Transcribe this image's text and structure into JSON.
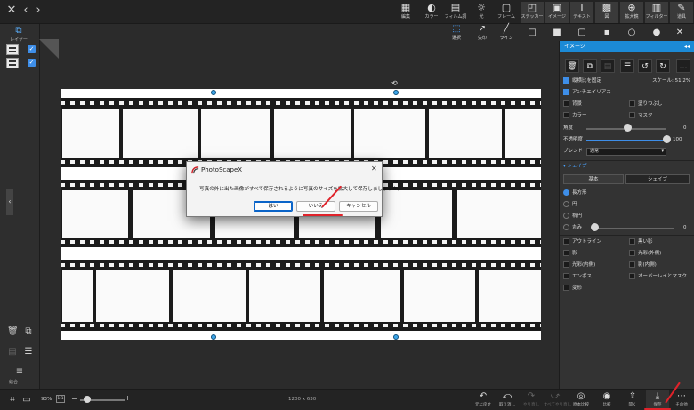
{
  "toolbar": {
    "tools": [
      {
        "label": "編集",
        "icon": "edit-icon"
      },
      {
        "label": "カラー",
        "icon": "color-icon"
      },
      {
        "label": "フィルム調",
        "icon": "film-icon"
      },
      {
        "label": "光",
        "icon": "light-icon"
      },
      {
        "label": "フレーム",
        "icon": "frame-icon"
      },
      {
        "label": "ステッカー",
        "icon": "sticker-icon"
      },
      {
        "label": "イメージ",
        "icon": "image-icon"
      },
      {
        "label": "テキスト",
        "icon": "text-icon"
      },
      {
        "label": "図",
        "icon": "figure-icon"
      },
      {
        "label": "拡大鏡",
        "icon": "magnifier-icon"
      },
      {
        "label": "フィルター",
        "icon": "filter-icon"
      },
      {
        "label": "道具",
        "icon": "tools-icon"
      }
    ]
  },
  "left_panel": {
    "layers_label": "レイヤー",
    "merge_label": "結合"
  },
  "select_tools": [
    {
      "label": "選択"
    },
    {
      "label": "矢印"
    },
    {
      "label": "ライン"
    }
  ],
  "right_panel": {
    "header": "イメージ",
    "scale_label": "スケール: 51.2%",
    "keep_ratio": "縦横比を固定",
    "antialias": "アンチエイリアス",
    "background": "背景",
    "fill": "塗りつぶし",
    "color": "カラー",
    "mask": "マスク",
    "angle_label": "角度",
    "angle_value": "0",
    "opacity_label": "不透明度",
    "opacity_value": "100",
    "opacity_fraction": 1.0,
    "blend_label": "ブレンド",
    "blend_value": "通常",
    "shape_section": "シェイプ",
    "seg_standard": "基本",
    "seg_shape": "シェイプ",
    "shape_rect": "長方形",
    "shape_circle": "円",
    "shape_ellipse": "楕円",
    "shape_round": "丸み",
    "shape_round_value": "0",
    "effects": [
      {
        "left": "アウトライン",
        "right": "黒い影"
      },
      {
        "left": "影",
        "right": "光彩(外側)"
      },
      {
        "left": "光彩(内側)",
        "right": "影(内側)"
      },
      {
        "left": "エンボス",
        "right": "オーバーレイとマスク"
      },
      {
        "left": "変形",
        "right": ""
      }
    ]
  },
  "dialog": {
    "title": "PhotoScapeX",
    "message": "写真の外に出た画像がすべて保存されるように写真のサイズを拡大して保存しましょうか。",
    "yes": "はい",
    "no": "いいえ",
    "cancel": "キャンセル"
  },
  "bottom": {
    "zoom": "93%",
    "zoom_fit": "1:1",
    "dimensions": "1200 x 630",
    "tools": [
      {
        "label": "元に戻す",
        "icon": "undo-icon"
      },
      {
        "label": "取り消し",
        "icon": "undo-all-icon"
      },
      {
        "label": "やり直し",
        "icon": "redo-icon"
      },
      {
        "label": "すべてやり直し",
        "icon": "redo-all-icon"
      },
      {
        "label": "原本比較",
        "icon": "compare-original-icon"
      },
      {
        "label": "比較",
        "icon": "compare-icon"
      },
      {
        "label": "開く",
        "icon": "open-icon"
      },
      {
        "label": "保存",
        "icon": "save-icon"
      },
      {
        "label": "その他",
        "icon": "more-icon"
      }
    ]
  },
  "colors": {
    "accent": "#1c8ad6",
    "annotation": "#e0222a"
  }
}
